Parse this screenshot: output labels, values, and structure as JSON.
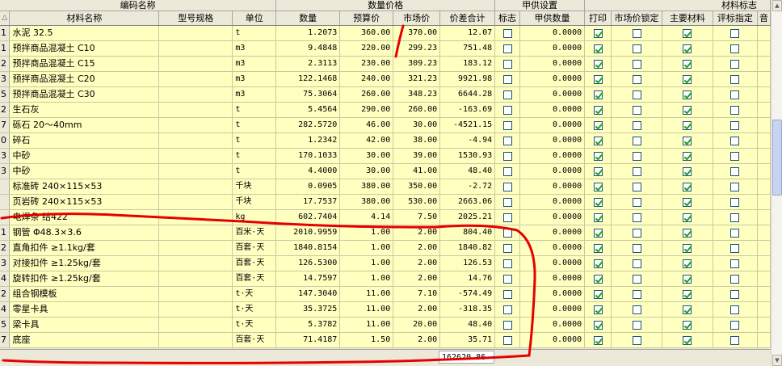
{
  "groups": [
    {
      "label": "编码名称"
    },
    {
      "label": "数量价格"
    },
    {
      "label": "甲供设置"
    },
    {
      "label": "材料标志"
    }
  ],
  "columns": {
    "sort_glyph": "△",
    "name": "材料名称",
    "spec": "型号规格",
    "unit": "单位",
    "qty": "数量",
    "budget_price": "预算价",
    "market_price": "市场价",
    "diff_total": "价差合计",
    "flag": "标志",
    "supply_qty": "甲供数量",
    "print": "打印",
    "market_lock": "市场价锁定",
    "main_material": "主要材料",
    "tender": "评标指定",
    "extra": "音"
  },
  "rows": [
    {
      "rn": "1",
      "name": "水泥 32.5",
      "spec": "",
      "unit": "t",
      "qty": "1.2073",
      "budget": "360.00",
      "market": "370.00",
      "diff": "12.07",
      "flag": false,
      "supply": "0.0000",
      "print": true,
      "lock": false,
      "main": true,
      "tender": false
    },
    {
      "rn": "1",
      "name": "预拌商品混凝土 C10",
      "spec": "",
      "unit": "m3",
      "qty": "9.4848",
      "budget": "220.00",
      "market": "299.23",
      "diff": "751.48",
      "flag": false,
      "supply": "0.0000",
      "print": true,
      "lock": false,
      "main": true,
      "tender": false
    },
    {
      "rn": "2",
      "name": "预拌商品混凝土 C15",
      "spec": "",
      "unit": "m3",
      "qty": "2.3113",
      "budget": "230.00",
      "market": "309.23",
      "diff": "183.12",
      "flag": false,
      "supply": "0.0000",
      "print": true,
      "lock": false,
      "main": true,
      "tender": false
    },
    {
      "rn": "3",
      "name": "预拌商品混凝土 C20",
      "spec": "",
      "unit": "m3",
      "qty": "122.1468",
      "budget": "240.00",
      "market": "321.23",
      "diff": "9921.98",
      "flag": false,
      "supply": "0.0000",
      "print": true,
      "lock": false,
      "main": true,
      "tender": false
    },
    {
      "rn": "5",
      "name": "预拌商品混凝土 C30",
      "spec": "",
      "unit": "m3",
      "qty": "75.3064",
      "budget": "260.00",
      "market": "348.23",
      "diff": "6644.28",
      "flag": false,
      "supply": "0.0000",
      "print": true,
      "lock": false,
      "main": true,
      "tender": false
    },
    {
      "rn": "2",
      "name": "生石灰",
      "spec": "",
      "unit": "t",
      "qty": "5.4564",
      "budget": "290.00",
      "market": "260.00",
      "diff": "-163.69",
      "flag": false,
      "supply": "0.0000",
      "print": true,
      "lock": false,
      "main": true,
      "tender": false
    },
    {
      "rn": "7",
      "name": "砾石 20～40mm",
      "spec": "",
      "unit": "t",
      "qty": "282.5720",
      "budget": "46.00",
      "market": "30.00",
      "diff": "-4521.15",
      "flag": false,
      "supply": "0.0000",
      "print": true,
      "lock": false,
      "main": true,
      "tender": false
    },
    {
      "rn": "0",
      "name": "碎石",
      "spec": "",
      "unit": "t",
      "qty": "1.2342",
      "budget": "42.00",
      "market": "38.00",
      "diff": "-4.94",
      "flag": false,
      "supply": "0.0000",
      "print": true,
      "lock": false,
      "main": true,
      "tender": false
    },
    {
      "rn": "3",
      "name": "中砂",
      "spec": "",
      "unit": "t",
      "qty": "170.1033",
      "budget": "30.00",
      "market": "39.00",
      "diff": "1530.93",
      "flag": false,
      "supply": "0.0000",
      "print": true,
      "lock": false,
      "main": true,
      "tender": false
    },
    {
      "rn": "3",
      "name": "中砂",
      "spec": "",
      "unit": "t",
      "qty": "4.4000",
      "budget": "30.00",
      "market": "41.00",
      "diff": "48.40",
      "flag": false,
      "supply": "0.0000",
      "print": true,
      "lock": false,
      "main": true,
      "tender": false
    },
    {
      "rn": "",
      "name": "标准砖 240×115×53",
      "spec": "",
      "unit": "千块",
      "qty": "0.0905",
      "budget": "380.00",
      "market": "350.00",
      "diff": "-2.72",
      "flag": false,
      "supply": "0.0000",
      "print": true,
      "lock": false,
      "main": true,
      "tender": false
    },
    {
      "rn": "",
      "name": "页岩砖 240×115×53",
      "spec": "",
      "unit": "千块",
      "qty": "17.7537",
      "budget": "380.00",
      "market": "530.00",
      "diff": "2663.06",
      "flag": false,
      "supply": "0.0000",
      "print": true,
      "lock": false,
      "main": true,
      "tender": false
    },
    {
      "rn": "",
      "name": "电焊条 结422",
      "spec": "",
      "unit": "kg",
      "qty": "602.7404",
      "budget": "4.14",
      "market": "7.50",
      "diff": "2025.21",
      "flag": false,
      "supply": "0.0000",
      "print": true,
      "lock": false,
      "main": true,
      "tender": false
    },
    {
      "rn": "1",
      "name": "钢管 Φ48.3×3.6",
      "spec": "",
      "unit": "百米·天",
      "qty": "2010.9959",
      "budget": "1.00",
      "market": "2.00",
      "diff": "804.40",
      "flag": false,
      "supply": "0.0000",
      "print": true,
      "lock": false,
      "main": true,
      "tender": false
    },
    {
      "rn": "2",
      "name": "直角扣件 ≥1.1kg/套",
      "spec": "",
      "unit": "百套·天",
      "qty": "1840.8154",
      "budget": "1.00",
      "market": "2.00",
      "diff": "1840.82",
      "flag": false,
      "supply": "0.0000",
      "print": true,
      "lock": false,
      "main": true,
      "tender": false
    },
    {
      "rn": "3",
      "name": "对接扣件 ≥1.25kg/套",
      "spec": "",
      "unit": "百套·天",
      "qty": "126.5300",
      "budget": "1.00",
      "market": "2.00",
      "diff": "126.53",
      "flag": false,
      "supply": "0.0000",
      "print": true,
      "lock": false,
      "main": true,
      "tender": false
    },
    {
      "rn": "4",
      "name": "旋转扣件 ≥1.25kg/套",
      "spec": "",
      "unit": "百套·天",
      "qty": "14.7597",
      "budget": "1.00",
      "market": "2.00",
      "diff": "14.76",
      "flag": false,
      "supply": "0.0000",
      "print": true,
      "lock": false,
      "main": true,
      "tender": false
    },
    {
      "rn": "2",
      "name": "组合钢模板",
      "spec": "",
      "unit": "t·天",
      "qty": "147.3040",
      "budget": "11.00",
      "market": "7.10",
      "diff": "-574.49",
      "flag": false,
      "supply": "0.0000",
      "print": true,
      "lock": false,
      "main": true,
      "tender": false
    },
    {
      "rn": "4",
      "name": "零星卡具",
      "spec": "",
      "unit": "t·天",
      "qty": "35.3725",
      "budget": "11.00",
      "market": "2.00",
      "diff": "-318.35",
      "flag": false,
      "supply": "0.0000",
      "print": true,
      "lock": false,
      "main": true,
      "tender": false
    },
    {
      "rn": "5",
      "name": "梁卡具",
      "spec": "",
      "unit": "t·天",
      "qty": "5.3782",
      "budget": "11.00",
      "market": "20.00",
      "diff": "48.40",
      "flag": false,
      "supply": "0.0000",
      "print": true,
      "lock": false,
      "main": true,
      "tender": false
    },
    {
      "rn": "7",
      "name": "底座",
      "spec": "",
      "unit": "百套·天",
      "qty": "71.4187",
      "budget": "1.50",
      "market": "2.00",
      "diff": "35.71",
      "flag": false,
      "supply": "0.0000",
      "print": true,
      "lock": false,
      "main": true,
      "tender": false
    }
  ],
  "footer": {
    "total": "162620.86"
  },
  "colors": {
    "row_bg": "#ffffc0",
    "header_bg": "#ece9d8",
    "annotation": "#e60000",
    "check": "#21a121"
  }
}
